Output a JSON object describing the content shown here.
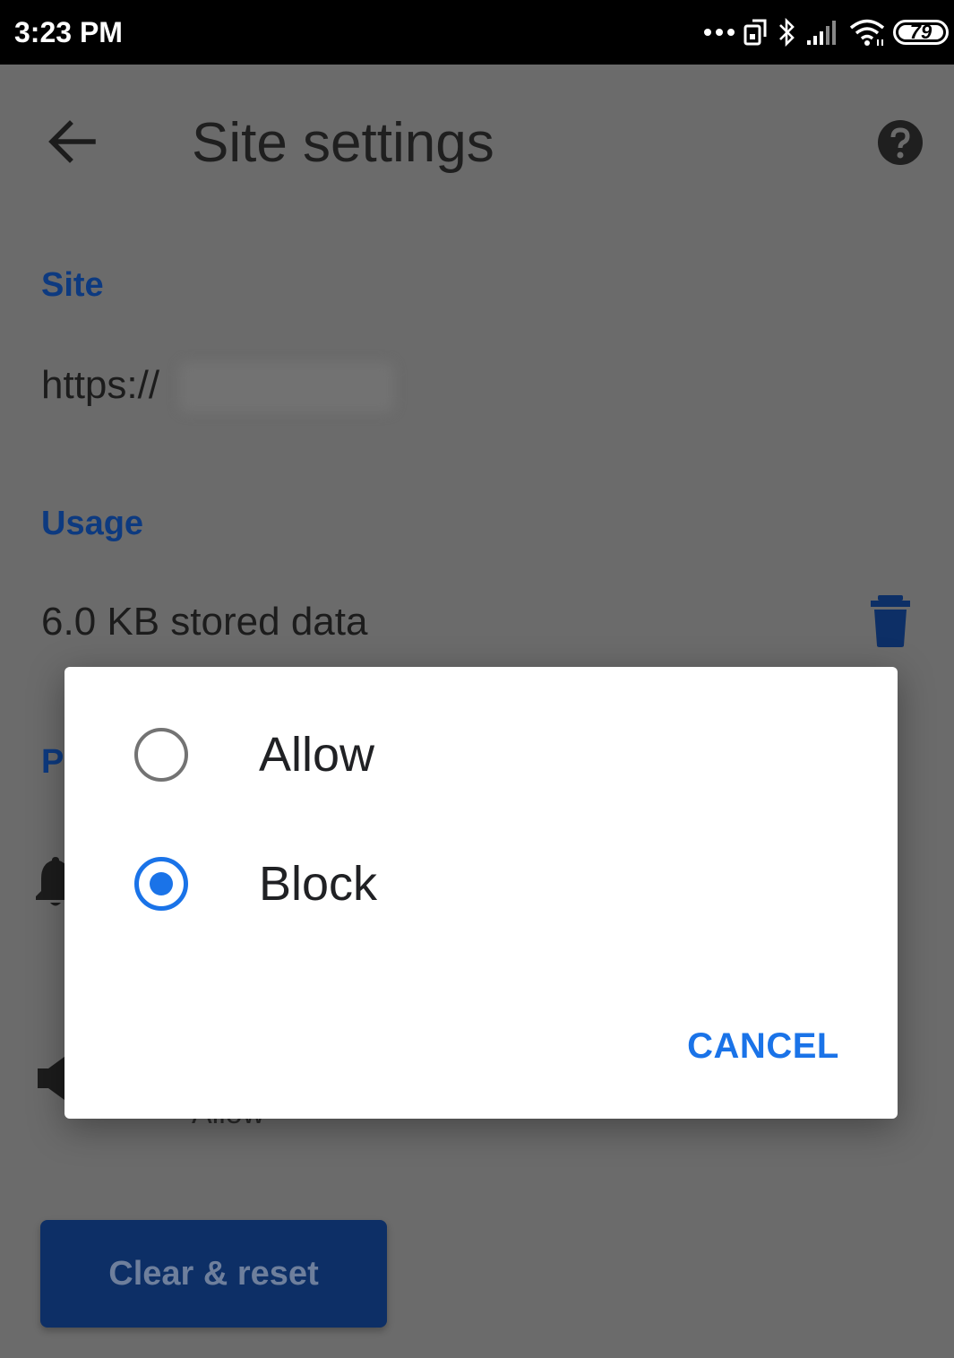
{
  "status_bar": {
    "time": "3:23 PM",
    "battery_level": "79",
    "icons": [
      "more-dots-icon",
      "screen-rotate-icon",
      "bluetooth-icon",
      "signal-icon",
      "wifi-icon",
      "battery-icon"
    ]
  },
  "toolbar": {
    "title": "Site settings",
    "back_icon": "arrow-left-icon",
    "help_icon": "help-circle-icon"
  },
  "site_section": {
    "header": "Site",
    "url_prefix": "https://"
  },
  "usage_section": {
    "header": "Usage",
    "stored_data": "6.0 KB stored data",
    "delete_icon": "trash-icon"
  },
  "permissions_section": {
    "header_visible": "P",
    "sound_value_peek": "Allow"
  },
  "clear_reset": {
    "label": "Clear & reset"
  },
  "dialog": {
    "options": [
      {
        "label": "Allow",
        "selected": false
      },
      {
        "label": "Block",
        "selected": true
      }
    ],
    "cancel_label": "CANCEL"
  },
  "colors": {
    "accent": "#1a73e8",
    "section_header": "#0d3a80",
    "scrim_background": "#6b6b6b",
    "dialog_background": "#ffffff"
  }
}
